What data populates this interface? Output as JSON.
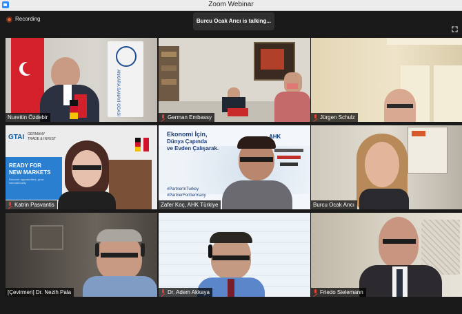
{
  "window": {
    "title": "Zoom Webinar"
  },
  "recording": {
    "label": "Recording"
  },
  "active_speaker_toast": "Burcu Ocak Arıcı is talking...",
  "colors": {
    "recording": "#e55c2e",
    "active_border": "#f2e36b",
    "muted_mic": "#d9413a"
  },
  "tiles": [
    {
      "name": "Nurettin Özdebir"
    },
    {
      "name": "German Embassy"
    },
    {
      "name": "Jürgen Schulz"
    },
    {
      "name": "Katrin Pasvantis"
    },
    {
      "name": "Zafer Koç, AHK Türkiye"
    },
    {
      "name": "Burcu Ocak Arıcı"
    },
    {
      "name": "[Çevirmen] Dr. Nezih Pala"
    },
    {
      "name": "Dr. Adem Akkaya"
    },
    {
      "name": "Friedo Sielemann"
    }
  ],
  "backgrounds": {
    "sanayi_banner": "ANKARA SANAYİ ODASI",
    "gtai_logo": "GTAI",
    "gtai_sub1": "GERMANY",
    "gtai_sub2": "TRADE & INVEST",
    "gtai_poster_1": "READY FOR",
    "gtai_poster_2": "NEW MARKETS",
    "gtai_poster_3": "Discover opportunities, grow internationally",
    "ahk_title_1": "Ekonomi İçin,",
    "ahk_title_2": "Dünya Çapında",
    "ahk_title_3": "ve Evden Çalışarak.",
    "ahk_tag_1": "#PartnerInTurkey",
    "ahk_tag_2": "#PartnerForGermany",
    "ahk_logo": "AHK"
  }
}
